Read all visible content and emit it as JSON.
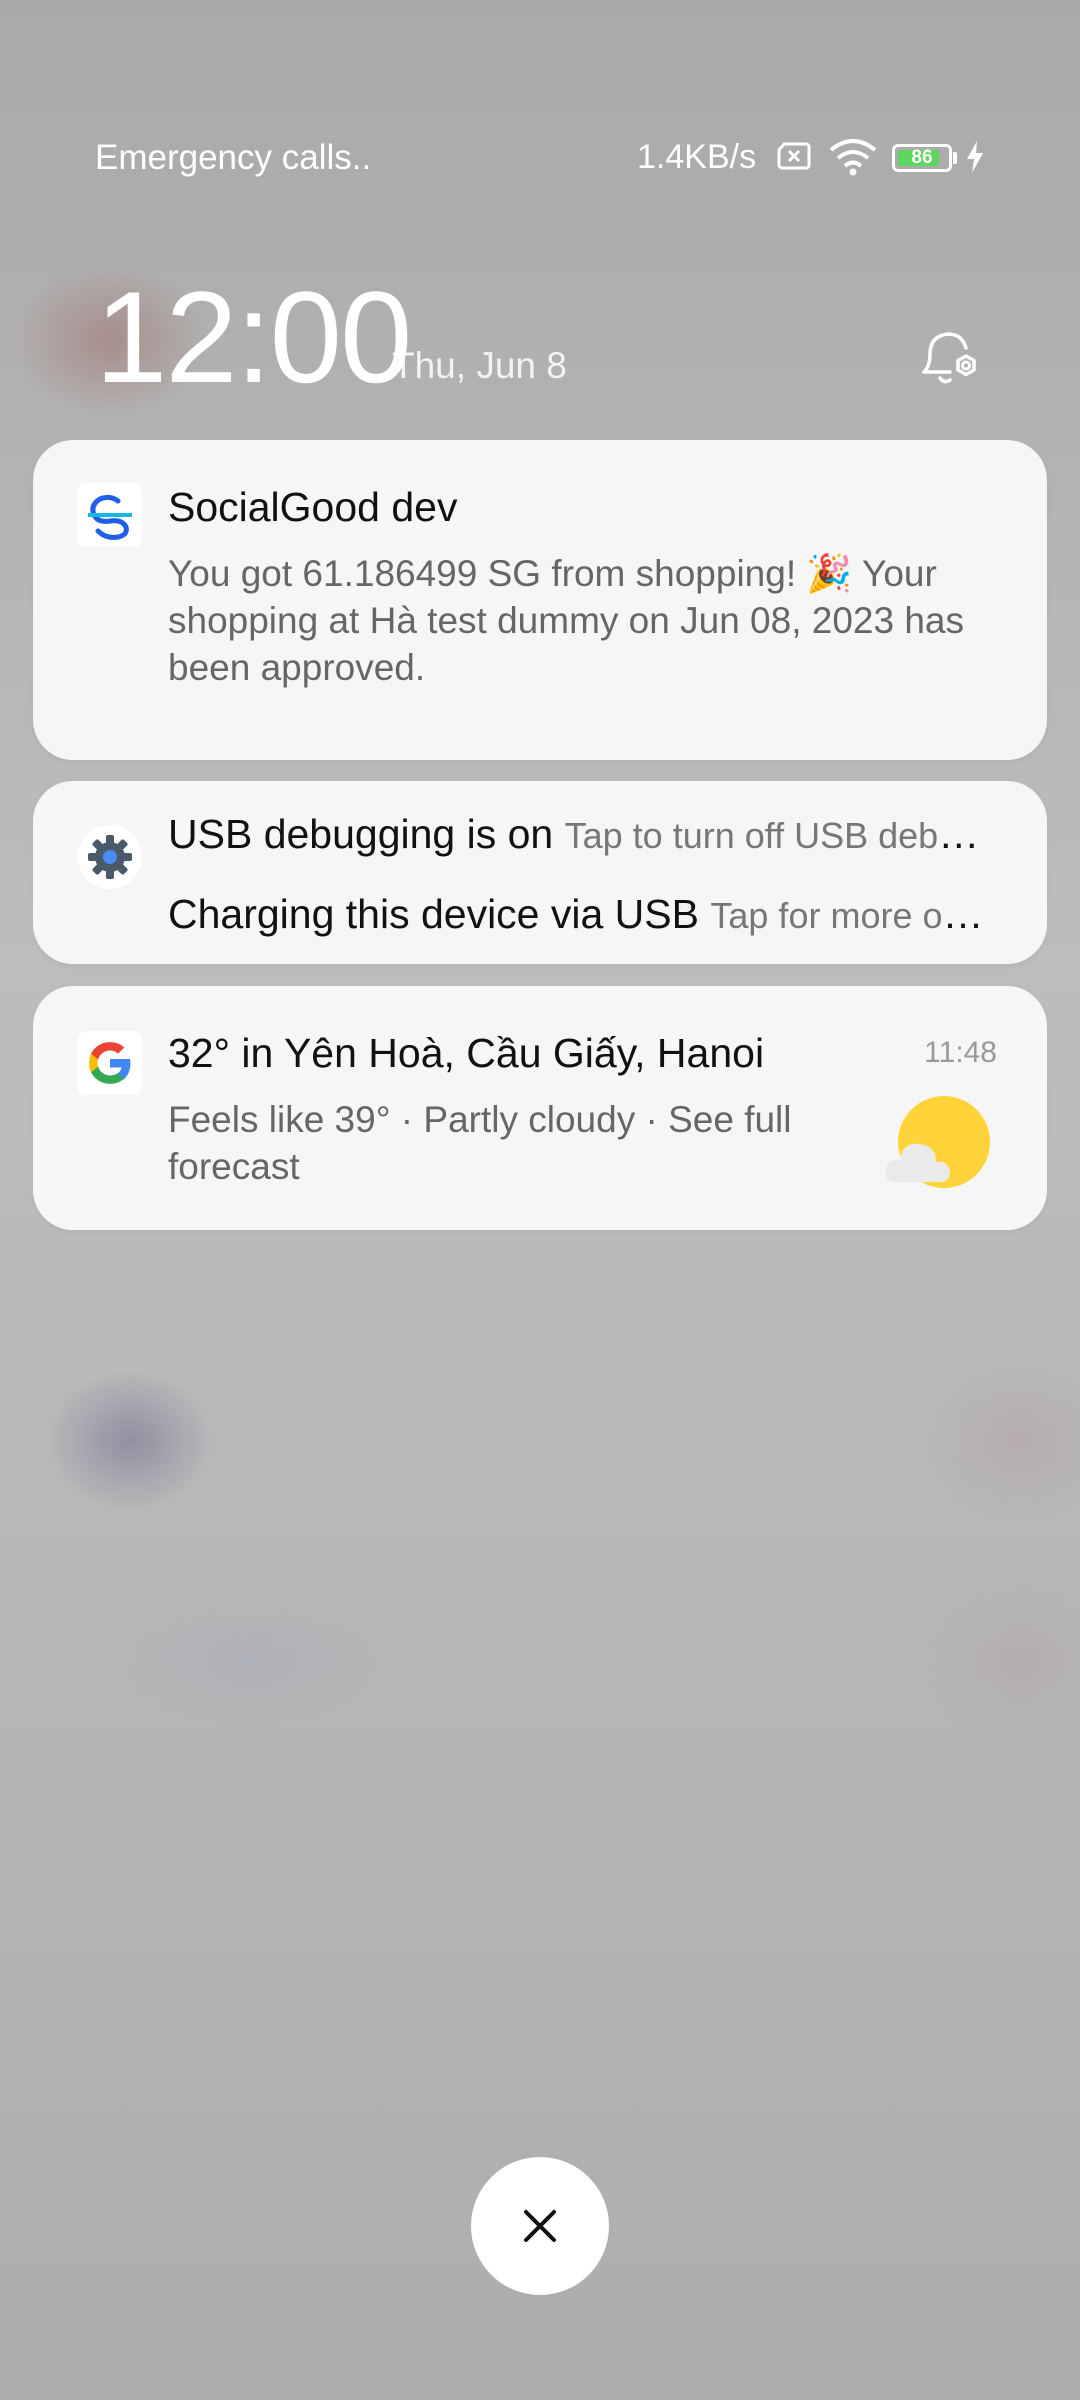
{
  "status_bar": {
    "carrier": "Emergency calls..",
    "network_speed": "1.4KB/s",
    "battery_level": "86",
    "battery_percent": 86,
    "icons": [
      "sim-absent-icon",
      "wifi-icon",
      "battery-icon",
      "charging-bolt-icon"
    ]
  },
  "lockscreen": {
    "time": "12:00",
    "date": "Thu, Jun 8",
    "bell_icon": "notification-settings-icon"
  },
  "notifications": [
    {
      "app_icon": "socialgood-logo-icon",
      "title": "SocialGood dev",
      "body": "You got 61.186499 SG from shopping! 🎉 Your shopping at Hà test dummy on Jun 08, 2023 has been approved."
    },
    {
      "app_icon": "android-system-gear-icon",
      "rows": [
        {
          "title": "USB debugging is on",
          "subtitle": "Tap to turn off USB debugging"
        },
        {
          "title": "Charging this device via USB",
          "subtitle": "Tap for more options."
        }
      ]
    },
    {
      "app_icon": "google-g-icon",
      "title": "32° in Yên Hoà, Cầu Giấy, Hanoi",
      "time": "11:48",
      "body": "Feels like 39° · Partly cloudy · See full forecast",
      "weather_icon": "partly-cloudy-icon"
    }
  ],
  "dismiss_icon": "close-icon",
  "colors": {
    "card_bg": "#f6f6f6",
    "battery_fill": "#5cd65c",
    "sun": "#ffd43b"
  }
}
